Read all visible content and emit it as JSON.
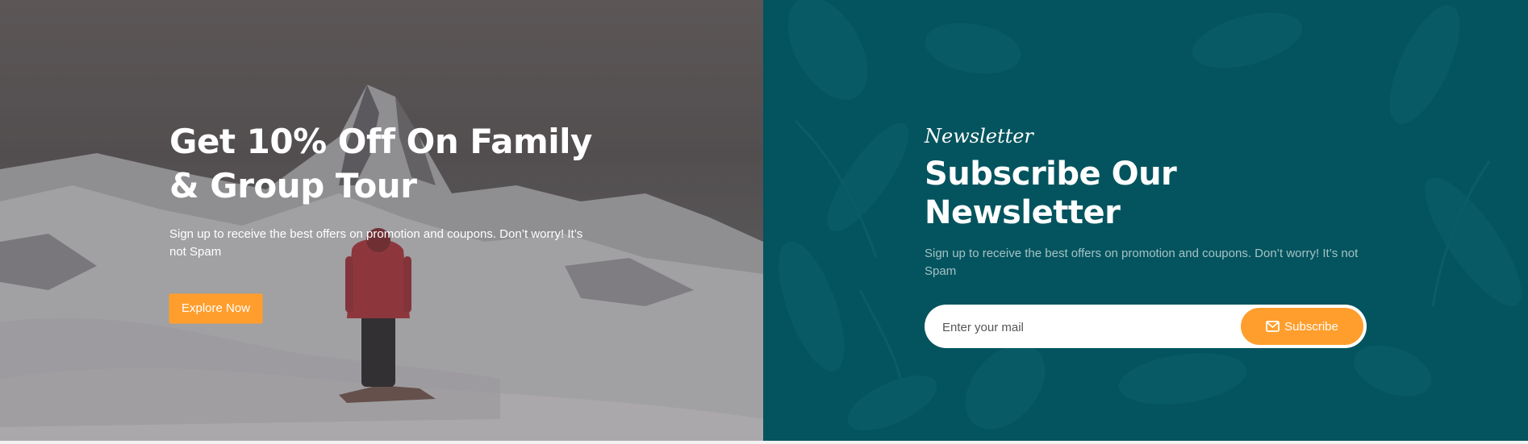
{
  "promo": {
    "title": "Get 10% Off On Family & Group Tour",
    "description": "Sign up to receive the best offers on promotion and coupons. Don’t worry! It’s not Spam",
    "button_label": "Explore Now",
    "button_color": "#ff9e2c",
    "image_icon": "mountain-hiker-photo"
  },
  "newsletter": {
    "kicker": "Newsletter",
    "title": "Subscribe Our Newsletter",
    "description": "Sign up to receive the best offers on promotion and coupons. Don’t worry! It’s not Spam",
    "input_placeholder": "Enter your mail",
    "input_value": "",
    "button_label": "Subscribe",
    "button_icon": "envelope-icon",
    "background_color": "#03545e",
    "accent_color": "#ff9e2c"
  }
}
